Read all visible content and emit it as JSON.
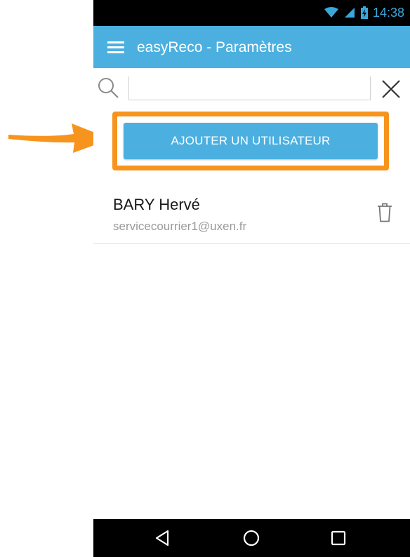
{
  "status_bar": {
    "time": "14:38",
    "icons": [
      "wifi-icon",
      "signal-icon",
      "battery-charging-icon"
    ],
    "time_color": "#3aa7d9"
  },
  "app_bar": {
    "title": "easyReco - Paramètres",
    "menu_icon": "menu-icon",
    "color": "#4bb0e0"
  },
  "search": {
    "value": "",
    "placeholder": "",
    "search_icon": "search-icon",
    "clear_icon": "close-icon"
  },
  "actions": {
    "add_user_label": "AJOUTER UN UTILISATEUR"
  },
  "users": [
    {
      "name": "BARY Hervé",
      "email": "servicecourrier1@uxen.fr",
      "delete_icon": "trash-icon"
    }
  ],
  "navigation": {
    "buttons": [
      "back-icon",
      "home-icon",
      "recents-icon"
    ]
  },
  "annotation": {
    "highlight_color": "#f7941d",
    "arrow_icon": "arrow-right-icon"
  }
}
